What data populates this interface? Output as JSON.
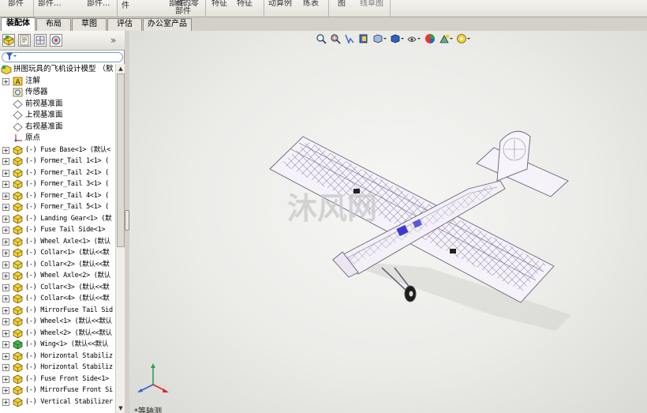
{
  "command_bar": {
    "items": [
      "部件",
      "部件...",
      "部件...",
      "件",
      "部件...",
      "藏的零部件",
      "特征",
      "特征",
      "动算例",
      "练表",
      "图",
      "线草图"
    ]
  },
  "tabs": [
    {
      "label": "装配体",
      "active": true
    },
    {
      "label": "布局",
      "active": false
    },
    {
      "label": "草图",
      "active": false
    },
    {
      "label": "评估",
      "active": false
    },
    {
      "label": "办公室产品",
      "active": false
    }
  ],
  "panel": {
    "collapse_label": "»",
    "filter_icon": "filter-icon"
  },
  "tree": {
    "root": "拼图玩具的飞机设计模型 （默",
    "items": [
      {
        "label": "注解",
        "kind": "annotation",
        "mono": false
      },
      {
        "label": "传感器",
        "kind": "sensor",
        "mono": false
      },
      {
        "label": "前视基准面",
        "kind": "plane",
        "mono": false
      },
      {
        "label": "上视基准面",
        "kind": "plane",
        "mono": false
      },
      {
        "label": "右视基准面",
        "kind": "plane",
        "mono": false
      },
      {
        "label": "原点",
        "kind": "origin",
        "mono": false
      },
      {
        "label": "(-) Fuse Base<1> (默认<",
        "kind": "part",
        "mono": true
      },
      {
        "label": "(-) Former_Tail 1<1> (",
        "kind": "part",
        "mono": true
      },
      {
        "label": "(-) Former_Tail 2<1> (",
        "kind": "part",
        "mono": true
      },
      {
        "label": "(-) Former_Tail 3<1> (",
        "kind": "part",
        "mono": true
      },
      {
        "label": "(-) Former_Tail 4<1> (",
        "kind": "part",
        "mono": true
      },
      {
        "label": "(-) Former_Tail 5<1> (",
        "kind": "part",
        "mono": true
      },
      {
        "label": "(-) Landing Gear<1> (默",
        "kind": "part",
        "mono": true
      },
      {
        "label": "(-) Fuse Tail Side<1>",
        "kind": "part",
        "mono": true
      },
      {
        "label": "(-) Wheel Axle<1> (默认",
        "kind": "part",
        "mono": true
      },
      {
        "label": "(-) Collar<1> (默认<<默",
        "kind": "part",
        "mono": true
      },
      {
        "label": "(-) Collar<2> (默认<<默",
        "kind": "part",
        "mono": true
      },
      {
        "label": "(-) Wheel Axle<2> (默认",
        "kind": "part",
        "mono": true
      },
      {
        "label": "(-) Collar<3> (默认<<默",
        "kind": "part",
        "mono": true
      },
      {
        "label": "(-) Collar<4> (默认<<默",
        "kind": "part",
        "mono": true
      },
      {
        "label": "(-) MirrorFuse Tail Sid",
        "kind": "part",
        "mono": true
      },
      {
        "label": "(-) Wheel<1> (默认<<默认",
        "kind": "part",
        "mono": true
      },
      {
        "label": "(-) Wheel<2> (默认<<默认",
        "kind": "part",
        "mono": true
      },
      {
        "label": "(-) Wing<1> (默认<<默认",
        "kind": "part-green",
        "mono": true
      },
      {
        "label": "(-) Horizontal Stabiliz",
        "kind": "part",
        "mono": true
      },
      {
        "label": "(-) Horizontal Stabiliz",
        "kind": "part",
        "mono": true
      },
      {
        "label": "(-) Fuse Front Side<1>",
        "kind": "part",
        "mono": true
      },
      {
        "label": "(-) MirrorFuse Front Si",
        "kind": "part",
        "mono": true
      },
      {
        "label": "(-) Vertical Stabilizer",
        "kind": "part",
        "mono": true
      }
    ]
  },
  "viewport": {
    "view_label": "*等轴测",
    "watermark": "沐风网",
    "heads_up_icons": [
      "zoom-to-fit-icon",
      "zoom-area-icon",
      "previous-view-icon",
      "section-view-icon",
      "view-orientation-icon",
      "display-style-icon",
      "hide-show-icon",
      "edit-appearance-icon",
      "scene-icon",
      "view-settings-icon"
    ]
  },
  "colors": {
    "viewport_bg": "#ebebe8",
    "model": "#f2eef6",
    "model_edge": "#6a6278",
    "accent_blue": "#3a3ad0"
  }
}
